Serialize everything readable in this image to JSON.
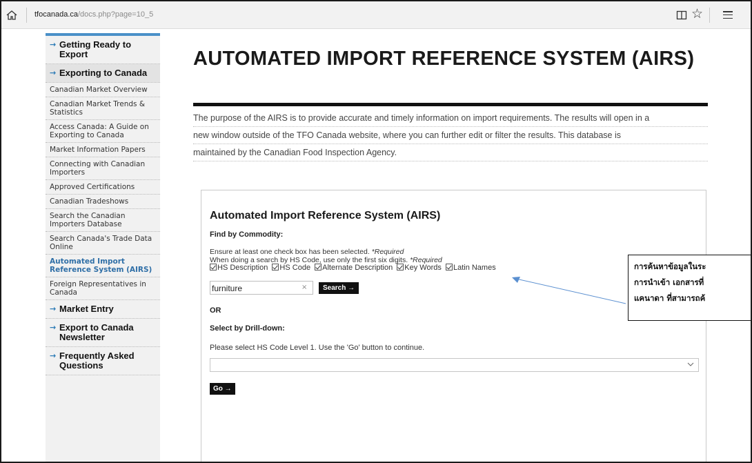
{
  "browser": {
    "url_host": "tfocanada.ca",
    "url_path": "/docs.php?page=10_5"
  },
  "sidebar": {
    "items": [
      {
        "label": "Getting Ready to Export",
        "kind": "main",
        "arrow": "→"
      },
      {
        "label": "Exporting to Canada",
        "kind": "main",
        "arrow": "→",
        "active": true
      },
      {
        "label": "Canadian Market Overview",
        "kind": "sub"
      },
      {
        "label": "Canadian Market Trends & Statistics",
        "kind": "sub"
      },
      {
        "label": "Access Canada: A Guide on Exporting to Canada",
        "kind": "sub"
      },
      {
        "label": "Market Information Papers",
        "kind": "sub"
      },
      {
        "label": "Connecting with Canadian Importers",
        "kind": "sub"
      },
      {
        "label": "Approved Certifications",
        "kind": "sub"
      },
      {
        "label": "Canadian Tradeshows",
        "kind": "sub"
      },
      {
        "label": "Search the Canadian Importers Database",
        "kind": "sub"
      },
      {
        "label": "Search Canada's Trade Data Online",
        "kind": "sub"
      },
      {
        "label": "Automated Import Reference System (AIRS)",
        "kind": "sub",
        "current": true
      },
      {
        "label": "Foreign Representatives in Canada",
        "kind": "sub"
      },
      {
        "label": "Market Entry",
        "kind": "main",
        "arrow": "→"
      },
      {
        "label": "Export to Canada Newsletter",
        "kind": "main",
        "arrow": "→"
      },
      {
        "label": "Frequently Asked Questions",
        "kind": "main",
        "arrow": "→"
      }
    ]
  },
  "main": {
    "title": "AUTOMATED IMPORT REFERENCE SYSTEM (AIRS)",
    "intro_lines": [
      "The purpose of the AIRS is to provide accurate and timely information on import requirements. The results will open in a",
      "new window outside of the TFO Canada website, where you can further edit or filter the results. This database is",
      "maintained by the Canadian Food Inspection Agency."
    ]
  },
  "form": {
    "title": "Automated Import Reference System (AIRS)",
    "find_label": "Find by Commodity:",
    "note1": "Ensure at least one check box has been selected.",
    "note1_required": "*Required",
    "note2": "When doing a search by HS Code, use only the first six digits.",
    "note2_required": "*Required",
    "checkboxes": [
      {
        "label": "HS Description",
        "checked": true
      },
      {
        "label": "HS Code",
        "checked": true
      },
      {
        "label": "Alternate Description",
        "checked": true
      },
      {
        "label": "Key Words",
        "checked": true
      },
      {
        "label": "Latin Names",
        "checked": true
      }
    ],
    "search_value": "furniture",
    "clear_glyph": "×",
    "search_button": "Search →",
    "or_label": "OR",
    "drill_label": "Select by Drill-down:",
    "drill_note": "Please select HS Code Level 1. Use the 'Go' button to continue.",
    "select_value": "",
    "go_button": "Go →"
  },
  "callout": {
    "lines": [
      "การค้นหาข้อมูลในระ",
      "การนำเข้า เอกสารที่",
      "แคนาดา ที่สามารถค้"
    ]
  }
}
